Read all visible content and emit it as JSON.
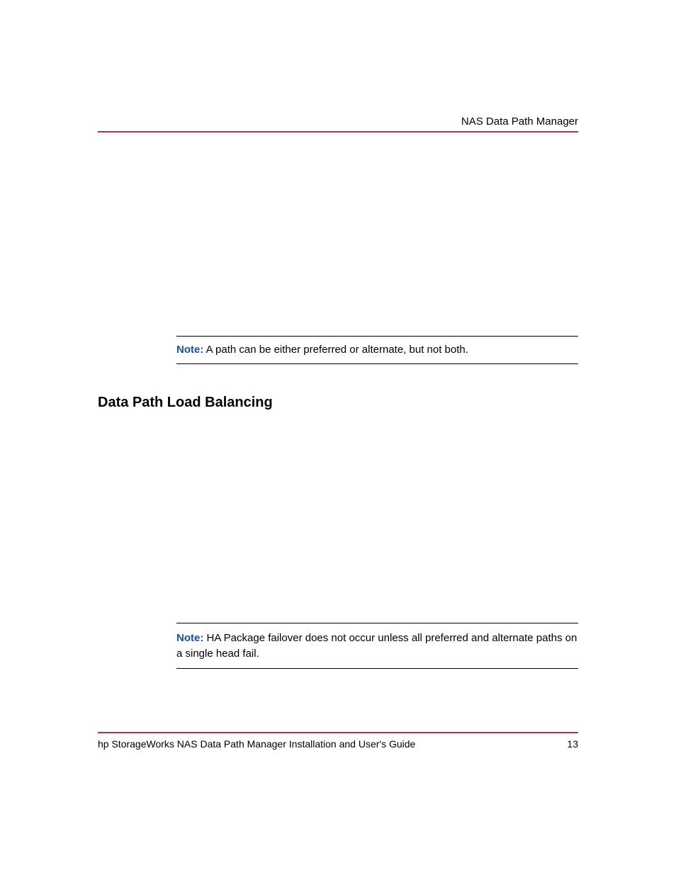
{
  "header": {
    "label": "NAS Data Path Manager"
  },
  "note1": {
    "label": "Note:",
    "text": "  A path can be either preferred or alternate, but not both."
  },
  "section": {
    "heading": "Data Path Load Balancing"
  },
  "note2": {
    "label": "Note:",
    "text": "  HA Package failover does not occur unless all preferred and alternate paths on a single head fail."
  },
  "footer": {
    "left": "hp StorageWorks NAS Data Path Manager Installation and User's Guide",
    "right": "13"
  }
}
